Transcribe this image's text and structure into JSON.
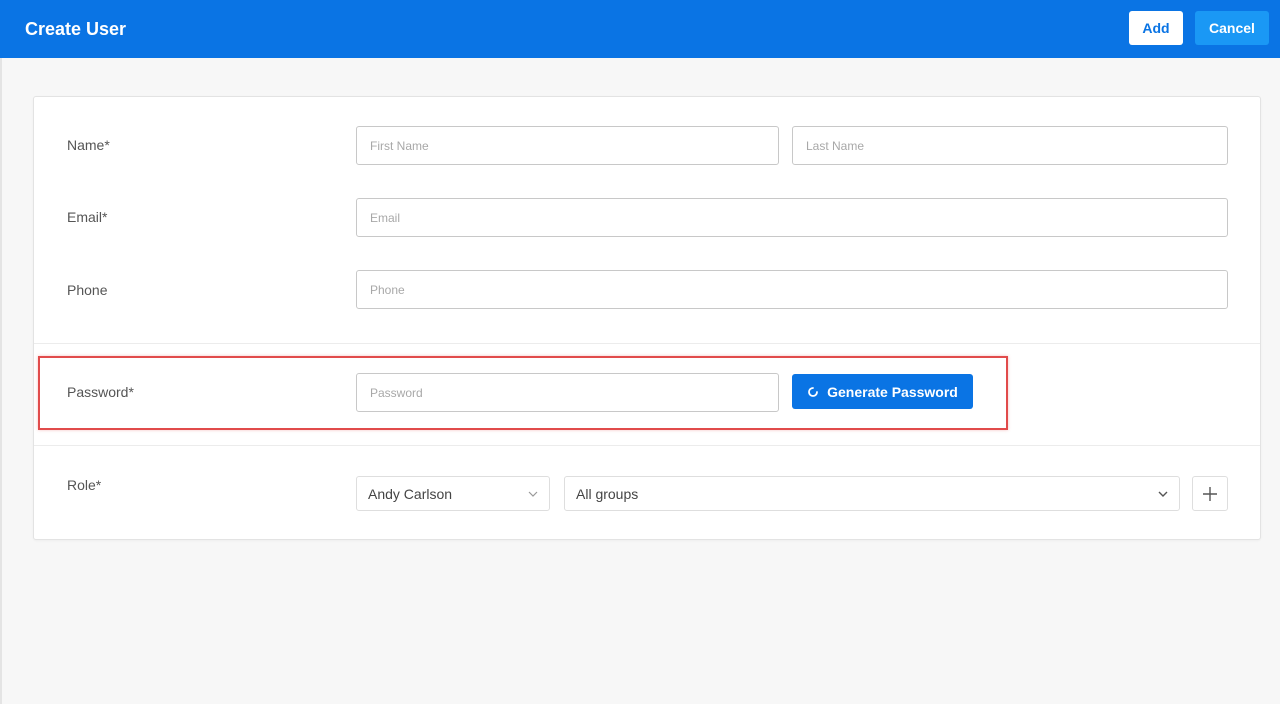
{
  "header": {
    "title": "Create User",
    "add_label": "Add",
    "cancel_label": "Cancel"
  },
  "form": {
    "name_label": "Name*",
    "first_name_placeholder": "First Name",
    "last_name_placeholder": "Last Name",
    "email_label": "Email*",
    "email_placeholder": "Email",
    "phone_label": "Phone",
    "phone_placeholder": "Phone",
    "password_label": "Password*",
    "password_placeholder": "Password",
    "generate_label": "Generate Password",
    "role_label": "Role*",
    "role_user_value": "Andy Carlson",
    "role_group_value": "All groups"
  },
  "colors": {
    "primary": "#0a74e4",
    "highlight": "#e14b4b"
  },
  "icons": [
    "refresh-icon",
    "chevron-down-icon",
    "plus-icon"
  ]
}
